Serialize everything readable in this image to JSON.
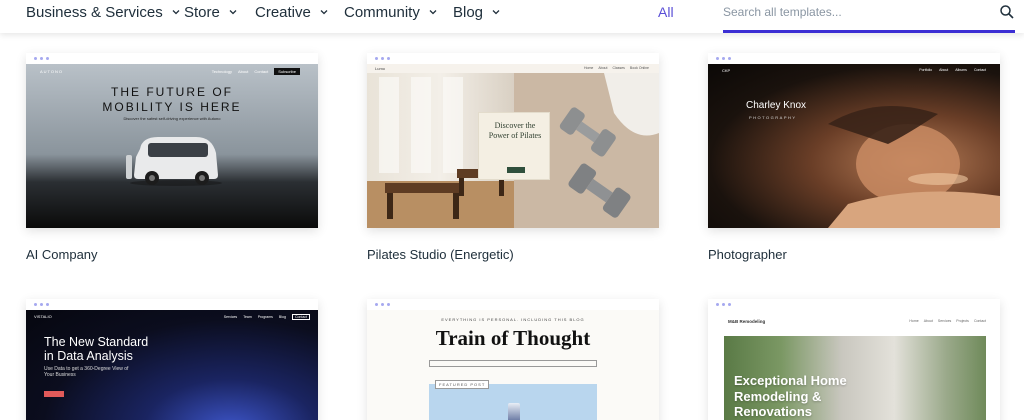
{
  "nav": {
    "items": [
      {
        "label": "Business & Services"
      },
      {
        "label": "Store"
      },
      {
        "label": "Creative"
      },
      {
        "label": "Community"
      },
      {
        "label": "Blog"
      }
    ],
    "all_label": "All",
    "search_placeholder": "Search all templates...",
    "accent": "#3c2fd4"
  },
  "cards": [
    {
      "title": "AI Company",
      "preview": {
        "logo": "AUTONO",
        "nav": [
          "Technology",
          "About",
          "Contact"
        ],
        "cta": "Subscribe",
        "headline_1": "THE FUTURE OF",
        "headline_2": "MOBILITY IS HERE",
        "tagline": "Discover the safest self-driving experience with Autono"
      }
    },
    {
      "title": "Pilates Studio (Energetic)",
      "preview": {
        "brand": "Lumo",
        "nav": [
          "Home",
          "About",
          "Classes",
          "Book Online"
        ],
        "headline_1": "Discover the",
        "headline_2": "Power of Pilates"
      }
    },
    {
      "title": "Photographer",
      "preview": {
        "logo": "CKP",
        "nav": [
          "Portfolio",
          "About",
          "Albums",
          "Contact"
        ],
        "name": "Charley Knox",
        "role": "PHOTOGRAPHY"
      }
    },
    {
      "title": "",
      "preview": {
        "logo": "VISTALIO",
        "nav": [
          "Services",
          "Team",
          "Programs",
          "Blog"
        ],
        "cta": "Contact",
        "headline_1": "The New Standard",
        "headline_2": "in Data Analysis",
        "subtext": "Use Data to get a 360-Degree View of Your Business"
      }
    },
    {
      "title": "",
      "preview": {
        "topline": "EVERYTHING IS PERSONAL. INCLUDING THIS BLOG",
        "title": "Train of Thought",
        "featured": "FEATURED POST"
      }
    },
    {
      "title": "",
      "preview": {
        "logo": "M&B Remodeling",
        "nav": [
          "Home",
          "About",
          "Services",
          "Projects",
          "Contact"
        ],
        "headline_1": "Exceptional Home",
        "headline_2": "Remodeling &",
        "headline_3": "Renovations"
      }
    }
  ]
}
